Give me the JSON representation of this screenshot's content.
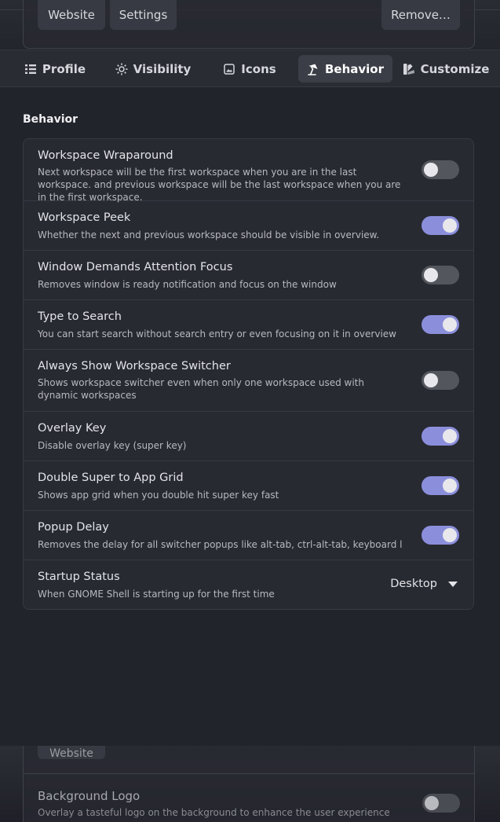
{
  "top_strip": {
    "buttons": [
      "Website",
      "Settings"
    ],
    "remove_label": "Remove…"
  },
  "tabs": [
    {
      "label": "Profile",
      "icon": "list-icon"
    },
    {
      "label": "Visibility",
      "icon": "sun-icon"
    },
    {
      "label": "Icons",
      "icon": "image-icon"
    },
    {
      "label": "Behavior",
      "icon": "desk-lamp-icon",
      "active": true
    },
    {
      "label": "Customize",
      "icon": "palette-icon"
    }
  ],
  "section_title": "Behavior",
  "rows": [
    {
      "title": "Workspace Wraparound",
      "subtitle": "Next workspace will be the first workspace when you are in the last workspace. and previous workspace will be the last workspace when you are in the first workspace.",
      "control": "switch",
      "on": false
    },
    {
      "title": "Workspace Peek",
      "subtitle": "Whether the next and previous workspace should be visible in overview.",
      "control": "switch",
      "on": true
    },
    {
      "title": "Window Demands Attention Focus",
      "subtitle": "Removes window is ready notification and focus on the window",
      "control": "switch",
      "on": false
    },
    {
      "title": "Type to Search",
      "subtitle": "You can start search without search entry or even focusing on it in overview",
      "control": "switch",
      "on": true
    },
    {
      "title": "Always Show Workspace Switcher",
      "subtitle": "Shows workspace switcher even when only one workspace used with dynamic workspaces",
      "control": "switch",
      "on": false
    },
    {
      "title": "Overlay Key",
      "subtitle": "Disable overlay key (super key)",
      "control": "switch",
      "on": true
    },
    {
      "title": "Double Super to App Grid",
      "subtitle": "Shows app grid when you double hit super key fast",
      "control": "switch",
      "on": true
    },
    {
      "title": "Popup Delay",
      "subtitle": "Removes the delay for all switcher popups like alt-tab, ctrl-alt-tab, keyboard layout, ...",
      "control": "switch",
      "on": true
    },
    {
      "title": "Startup Status",
      "subtitle": "When GNOME Shell is starting up for the first time",
      "control": "dropdown",
      "value": "Desktop"
    }
  ],
  "bottom_strip": {
    "button": "Website",
    "row_title": "Background Logo",
    "row_subtitle": "Overlay a tasteful logo on the background to enhance the user experience",
    "row_on": false
  },
  "colors": {
    "accent": "#8b8fdb",
    "switch_off": "#54565e",
    "window_bg": "#22242c"
  }
}
